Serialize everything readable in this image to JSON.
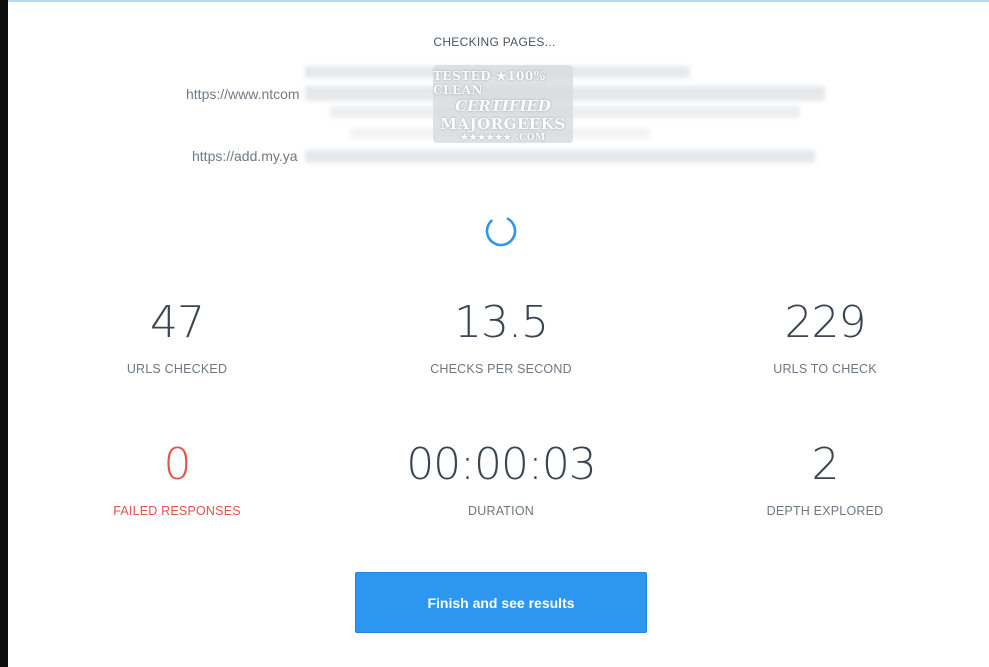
{
  "status": {
    "title": "CHECKING PAGES..."
  },
  "checking_urls": [
    {
      "text": "https://www.ntcom"
    },
    {
      "text": "https://add.my.ya"
    }
  ],
  "watermark": {
    "line1": "TESTED ★100% CLEAN",
    "line2": "CERTIFIED",
    "line3": "MAJORGEEKS",
    "line4": "★★★★★★ .COM"
  },
  "stats": {
    "urls_checked": {
      "value": "47",
      "label": "URLS CHECKED"
    },
    "checks_per_second": {
      "value": "13.5",
      "label": "CHECKS PER SECOND"
    },
    "urls_to_check": {
      "value": "229",
      "label": "URLS TO CHECK"
    },
    "failed_responses": {
      "value": "0",
      "label": "FAILED RESPONSES"
    },
    "duration": {
      "value": "00:00:03",
      "label": "DURATION"
    },
    "depth_explored": {
      "value": "2",
      "label": "DEPTH EXPLORED"
    }
  },
  "actions": {
    "finish_label": "Finish and see results"
  },
  "colors": {
    "accent": "#2d96ef",
    "error": "#e5514b",
    "value_text": "#3b4550",
    "label_text": "#6d7882"
  },
  "icons": {
    "spinner": "loading-spinner-icon"
  }
}
